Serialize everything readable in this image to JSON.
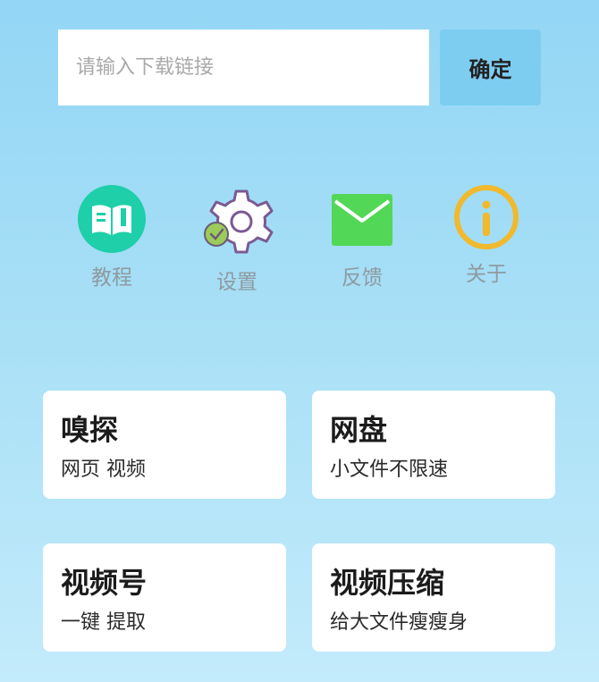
{
  "search": {
    "placeholder": "请输入下载链接",
    "confirm_label": "确定"
  },
  "quick_actions": [
    {
      "label": "教程",
      "icon": "book-icon",
      "color": "#1ecfa9"
    },
    {
      "label": "设置",
      "icon": "gear-icon",
      "color": "#8b6a9e"
    },
    {
      "label": "反馈",
      "icon": "mail-icon",
      "color": "#52d757"
    },
    {
      "label": "关于",
      "icon": "info-icon",
      "color": "#f1b92b"
    }
  ],
  "cards": [
    {
      "title": "嗅探",
      "subtitle": "网页 视频"
    },
    {
      "title": "网盘",
      "subtitle": "小文件不限速"
    },
    {
      "title": "视频号",
      "subtitle": "一键 提取"
    },
    {
      "title": "视频压缩",
      "subtitle": "给大文件瘦瘦身"
    }
  ]
}
